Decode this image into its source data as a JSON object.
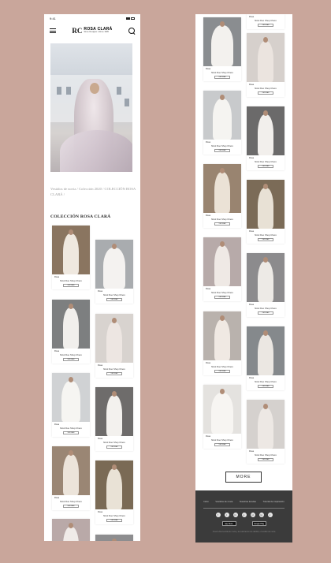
{
  "status": {
    "time": "9:41"
  },
  "logo": {
    "mark": "RC",
    "name": "ROSA CLARÁ",
    "sub": "Since Designer | Since 1995"
  },
  "breadcrumb": "Vestidos de novia / Colección 2020 / COLECCIÓN ROSA CLARÁ /",
  "collection_title": "COLECCIÓN ROSA CLARÁ",
  "product": {
    "brand": "Rosa",
    "name": "Nicol Duo Shop Chero",
    "button": "VER MAS"
  },
  "more_button": "MORE",
  "footer": {
    "nav": [
      "Inicio",
      "Vestidos de novia",
      "Nuestras tiendas",
      "Tutorial de inspiración"
    ],
    "socials": [
      "f",
      "t",
      "in",
      "p",
      "yt",
      "ig",
      "v"
    ],
    "stores": [
      "App Store",
      "Google Play"
    ],
    "text": "Crea la bienvenida de novia y la celebración de calidad, el vestido de novia"
  },
  "colors": {
    "background": "#c9a69b",
    "footer": "#3b3b3b"
  }
}
